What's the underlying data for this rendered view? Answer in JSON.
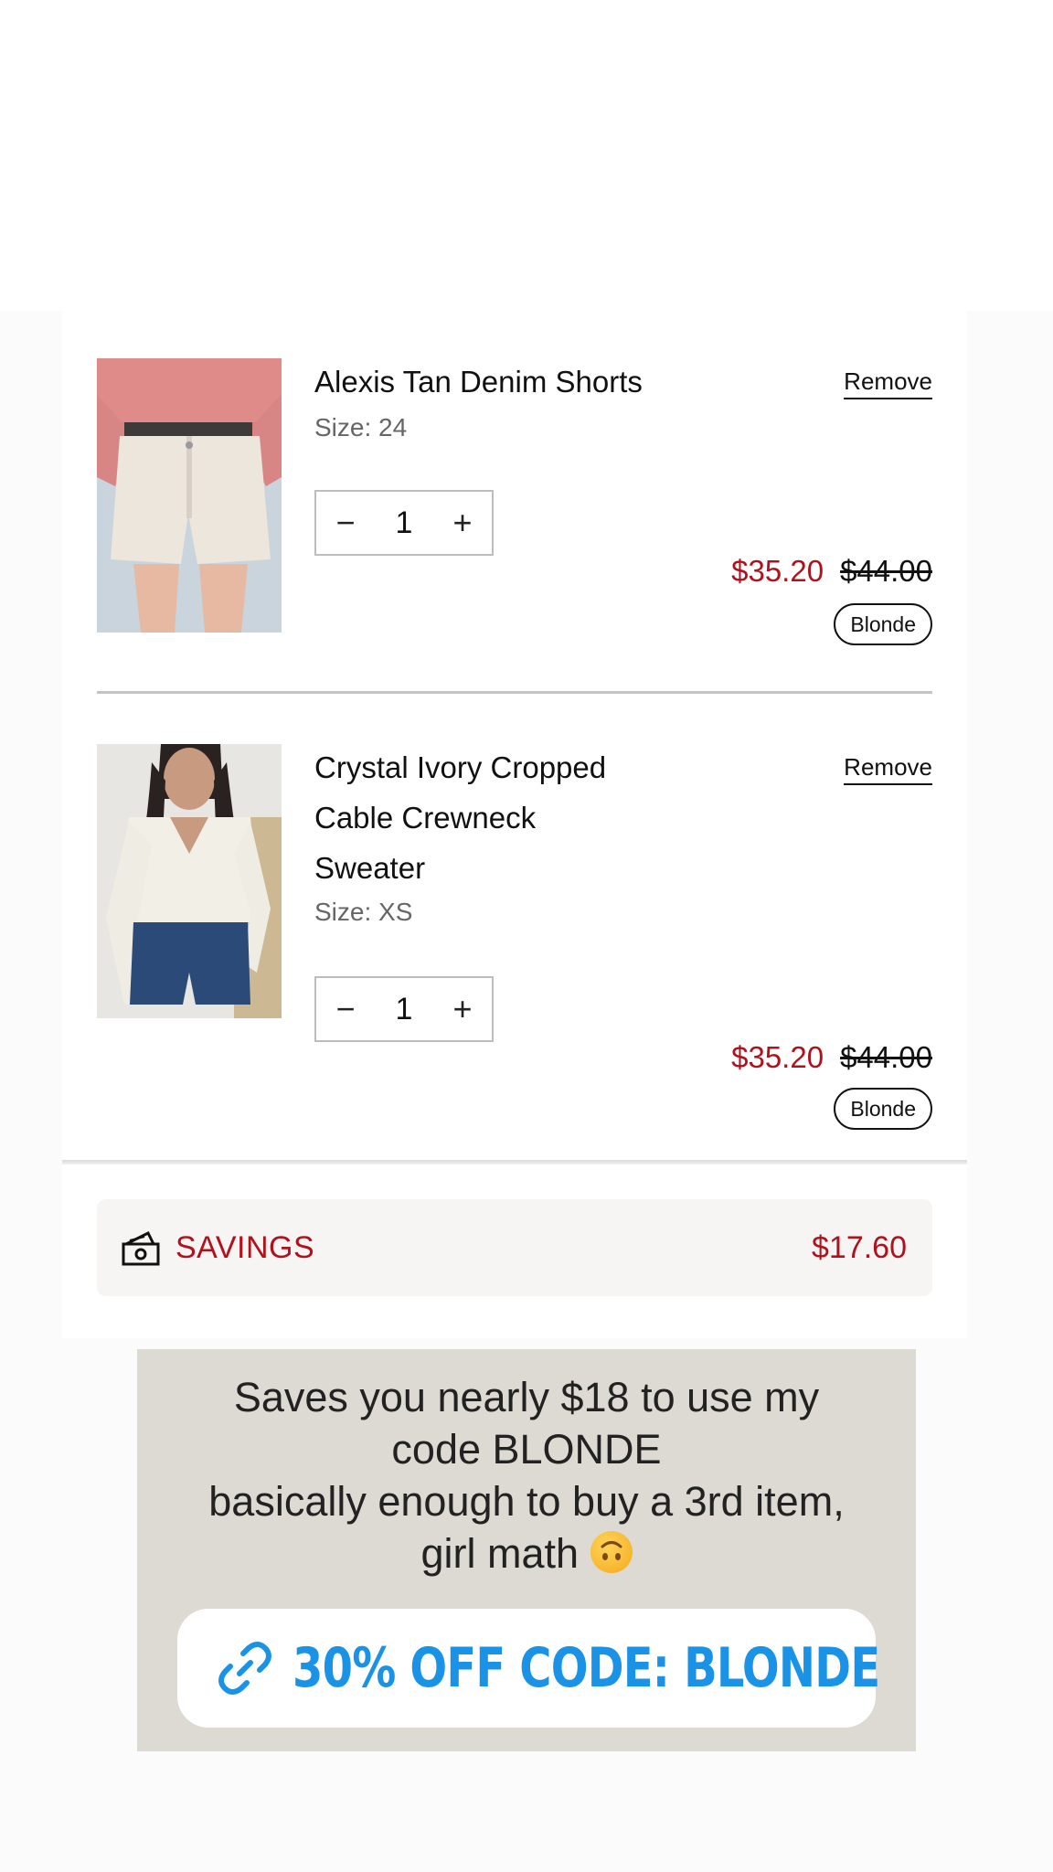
{
  "cart": {
    "items": [
      {
        "title": "Alexis Tan Denim Shorts",
        "size": "Size: 24",
        "remove_label": "Remove",
        "quantity": "1",
        "minus": "−",
        "plus": "+",
        "sale_price": "$35.20",
        "original_price": "$44.00",
        "code_badge": "Blonde"
      },
      {
        "title": "Crystal Ivory Cropped Cable Crewneck Sweater",
        "size": "Size: XS",
        "remove_label": "Remove",
        "quantity": "1",
        "minus": "−",
        "plus": "+",
        "sale_price": "$35.20",
        "original_price": "$44.00",
        "code_badge": "Blonde"
      }
    ]
  },
  "savings": {
    "icon": "money-icon",
    "label": "SAVINGS",
    "amount": "$17.60"
  },
  "story": {
    "lines": [
      "Saves you nearly $18 to use my",
      "code BLONDE",
      "basically enough to buy a 3rd item,",
      "girl math"
    ],
    "emoji": "upside-down-face-emoji",
    "link_icon": "link-icon",
    "link_label": "30% OFF CODE: BLONDE"
  },
  "colors": {
    "sale_red": "#b0121d",
    "story_background": "#dcdad2",
    "link_blue": "#1a93e6"
  }
}
